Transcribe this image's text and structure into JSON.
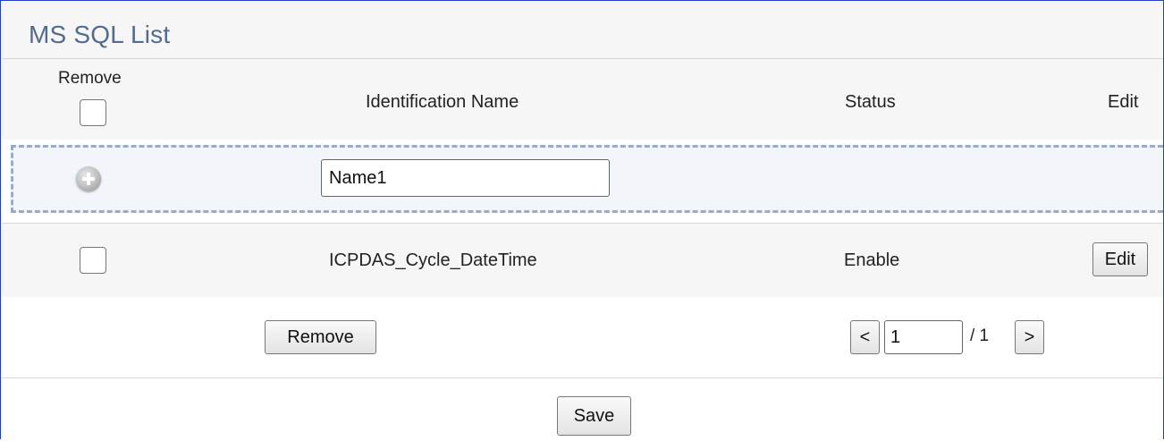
{
  "panel": {
    "title": "MS SQL List"
  },
  "table": {
    "headers": {
      "remove": "Remove",
      "identification_name": "Identification Name",
      "status": "Status",
      "edit": "Edit"
    },
    "add_row": {
      "name_value": "Name1"
    },
    "rows": [
      {
        "name": "ICPDAS_Cycle_DateTime",
        "status": "Enable",
        "edit_label": "Edit",
        "checked": false
      }
    ]
  },
  "actions": {
    "remove_label": "Remove",
    "prev_label": "<",
    "page_value": "1",
    "total_pages": "/ 1",
    "next_label": ">",
    "save_label": "Save"
  },
  "colors": {
    "frame_border": "#1f3fc8",
    "title": "#536b8f",
    "dashed_border": "#9aabc8",
    "add_row_bg": "#f2f5fa"
  }
}
